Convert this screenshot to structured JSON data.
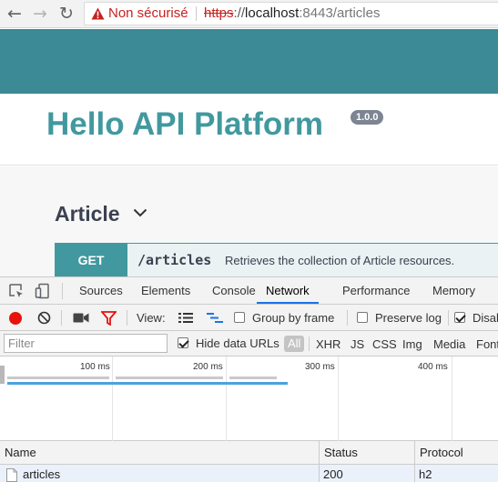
{
  "browser": {
    "back_glyph": "←",
    "forward_glyph": "→",
    "reload_glyph": "↻",
    "security_label": "Non sécurisé",
    "url_scheme": "https",
    "url_sep": "://",
    "url_host": "localhost",
    "url_rest": ":8443/articles"
  },
  "page": {
    "title": "Hello API Platform",
    "version": "1.0.0",
    "resource": "Article",
    "operation": {
      "method": "GET",
      "path": "/articles",
      "summary": "Retrieves the collection of Article resources."
    }
  },
  "devtools": {
    "tabs": [
      "Sources",
      "Elements",
      "Console",
      "Network",
      "Performance",
      "Memory"
    ],
    "active_tab": "Network",
    "toolbar": {
      "view_label": "View:",
      "group_by_frame": "Group by frame",
      "group_by_frame_checked": false,
      "preserve_log": "Preserve log",
      "preserve_log_checked": false,
      "disable_cache": "Disab",
      "disable_cache_checked": true
    },
    "filter": {
      "placeholder": "Filter",
      "hide_data_urls": "Hide data URLs",
      "hide_data_urls_checked": true,
      "types": [
        "All",
        "XHR",
        "JS",
        "CSS",
        "Img",
        "Media",
        "Font"
      ]
    },
    "timeline": {
      "ticks": [
        "100 ms",
        "200 ms",
        "300 ms",
        "400 ms"
      ]
    },
    "table": {
      "columns": [
        "Name",
        "Status",
        "Protocol"
      ],
      "rows": [
        {
          "name": "articles",
          "status": "200",
          "protocol": "h2"
        }
      ]
    }
  },
  "colors": {
    "accent": "#41999f",
    "header": "#3b8a96",
    "insecure": "#c5221f",
    "record": "#e8110f",
    "active_tab": "#1a73e8"
  }
}
